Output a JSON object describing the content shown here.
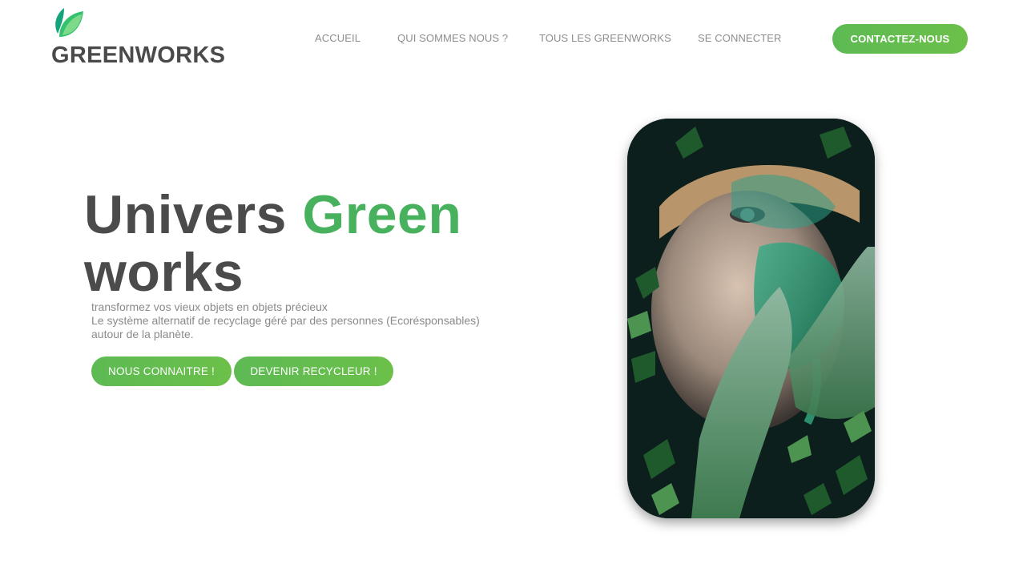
{
  "brand": {
    "name": "GREENWORKS",
    "logo_icon": "leaf-icon",
    "colors": {
      "primary": "#5dba53",
      "accent_text": "#48b15d",
      "heading": "#4b4b4b",
      "nav_text": "#8e8e8e"
    }
  },
  "nav": {
    "items": [
      {
        "label": "ACCUEIL"
      },
      {
        "label": "QUI SOMMES NOUS ?"
      },
      {
        "label": "TOUS LES GREENWORKS"
      },
      {
        "label": "SE CONNECTER"
      }
    ],
    "cta_label": "CONTACTEZ-NOUS"
  },
  "hero": {
    "title_part1": "Univers ",
    "title_accent": "Green",
    "title_part2": "works",
    "desc_line1": "transformez vos vieux objets en objets précieux",
    "desc_line2": "Le système alternatif de recyclage géré par des personnes (Ecorésponsables)",
    "desc_line3": "autour de la planète.",
    "btn_primary": "NOUS CONNAITRE !",
    "btn_secondary": "DEVENIR RECYCLEUR !"
  },
  "image": {
    "subject": "portrait-photo"
  }
}
